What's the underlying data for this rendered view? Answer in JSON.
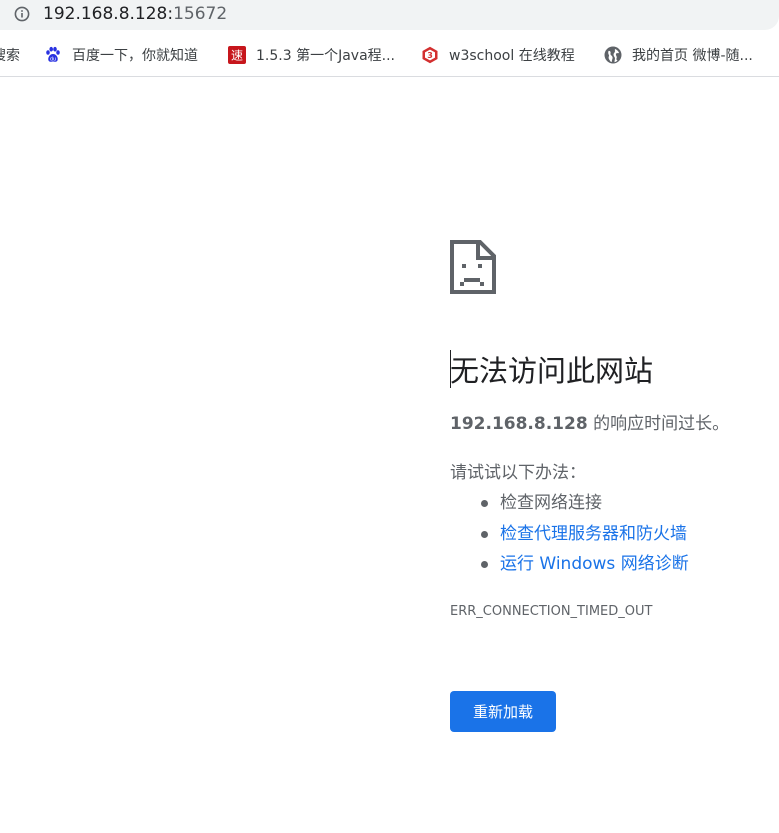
{
  "address_bar": {
    "host": "192.168.8.128:",
    "port": "15672"
  },
  "bookmarks": [
    {
      "icon": "text-fragment",
      "label": "搜索"
    },
    {
      "icon": "baidu-paw-icon",
      "label": "百度一下，你就知道"
    },
    {
      "icon": "su-red-icon",
      "label": "1.5.3 第一个Java程..."
    },
    {
      "icon": "w3school-icon",
      "label": "w3school 在线教程"
    },
    {
      "icon": "globe-icon",
      "label": "我的首页 微博-随..."
    }
  ],
  "error_page": {
    "title": "无法访问此网站",
    "host": "192.168.8.128",
    "description_suffix": " 的响应时间过长。",
    "try_heading": "请试试以下办法：",
    "suggestions": [
      {
        "label": "检查网络连接",
        "is_link": false
      },
      {
        "label": "检查代理服务器和防火墙",
        "is_link": true
      },
      {
        "label": "运行 Windows 网络诊断",
        "is_link": true
      }
    ],
    "error_code": "ERR_CONNECTION_TIMED_OUT",
    "reload_label": "重新加载"
  },
  "colors": {
    "link": "#1a73e8",
    "button": "#1a73e8",
    "text_secondary": "#5f6368",
    "text_primary": "#202124"
  }
}
